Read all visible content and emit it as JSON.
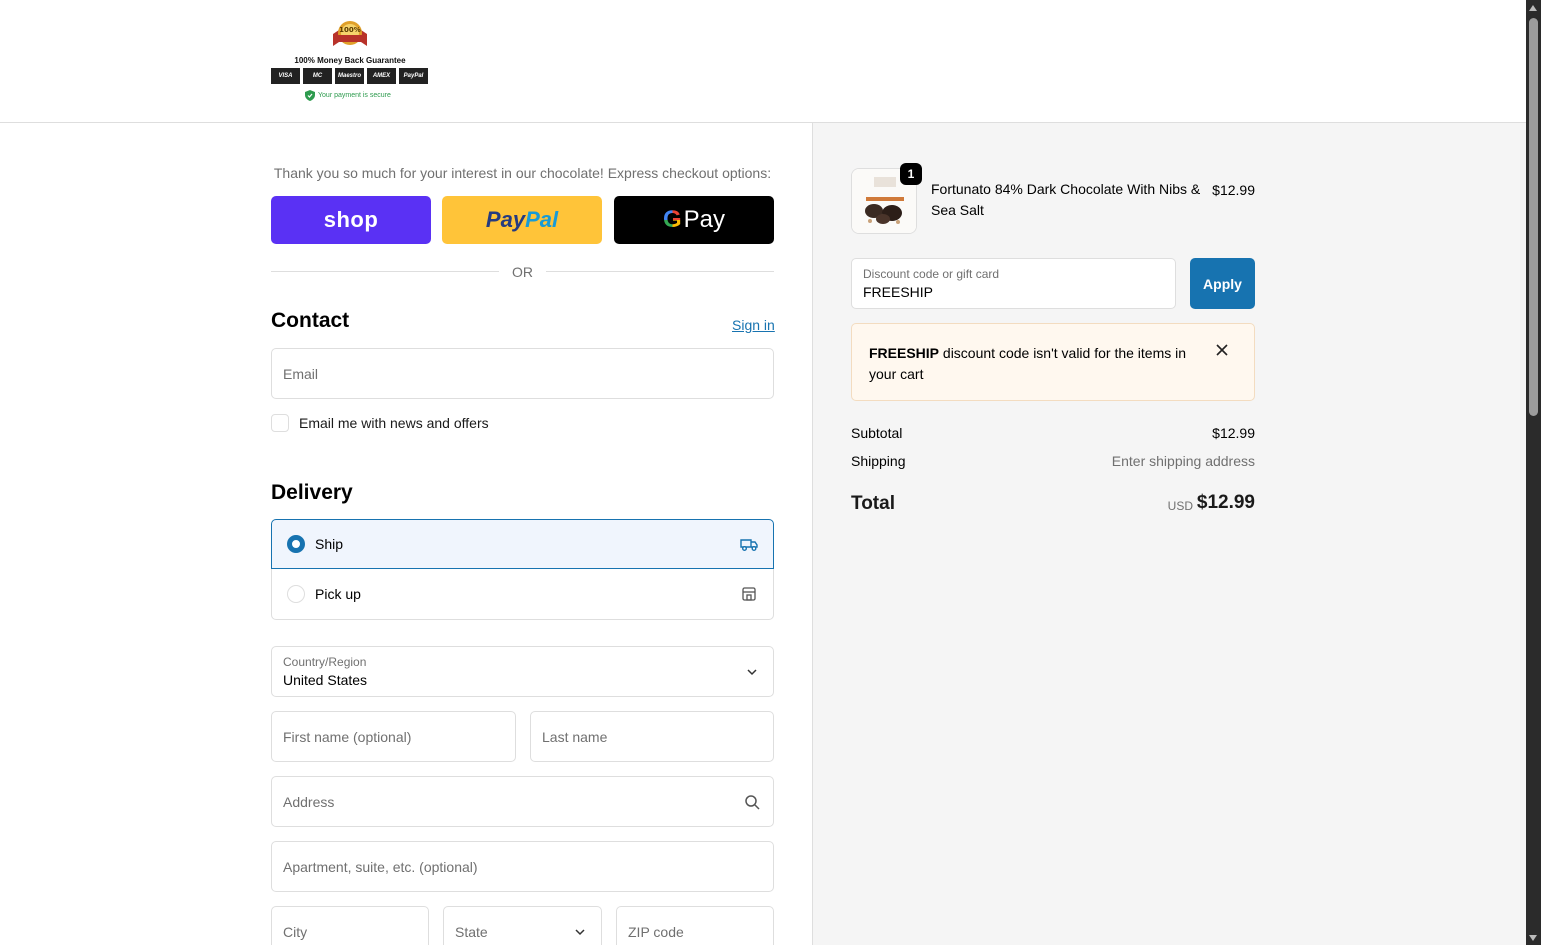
{
  "header": {
    "logo": {
      "seal_text": "100%",
      "guarantee": "100% Money Back Guarantee",
      "cards": [
        "VISA",
        "MC",
        "Maestro",
        "AMEX",
        "PayPal"
      ],
      "secure": "Your payment is secure"
    }
  },
  "express": {
    "title": "Thank you so much for your interest in our chocolate! Express checkout options:",
    "shop_label": "shop",
    "paypal_pay": "Pay",
    "paypal_pal": "Pal",
    "gpay_g": "G",
    "gpay_pay": "Pay",
    "or_label": "OR"
  },
  "contact": {
    "title": "Contact",
    "signin": "Sign in",
    "email_placeholder": "Email",
    "newsletter_label": "Email me with news and offers"
  },
  "delivery": {
    "title": "Delivery",
    "options": [
      {
        "label": "Ship",
        "selected": true,
        "icon": "truck-icon"
      },
      {
        "label": "Pick up",
        "selected": false,
        "icon": "store-icon"
      }
    ],
    "country_label": "Country/Region",
    "country_value": "United States",
    "first_name_placeholder": "First name (optional)",
    "last_name_placeholder": "Last name",
    "address_placeholder": "Address",
    "apartment_placeholder": "Apartment, suite, etc. (optional)",
    "city_placeholder": "City",
    "state_placeholder": "State",
    "zip_placeholder": "ZIP code"
  },
  "cart": {
    "item": {
      "quantity": "1",
      "name": "Fortunato 84% Dark Chocolate With Nibs & Sea Salt",
      "price": "$12.99"
    },
    "discount": {
      "label": "Discount code or gift card",
      "value": "FREESHIP",
      "apply_label": "Apply"
    },
    "notice": {
      "code": "FREESHIP",
      "message": " discount code isn't valid for the items in your cart"
    },
    "subtotal_label": "Subtotal",
    "subtotal_value": "$12.99",
    "shipping_label": "Shipping",
    "shipping_value": "Enter shipping address",
    "total_label": "Total",
    "currency": "USD",
    "total_value": "$12.99"
  },
  "colors": {
    "accent": "#1773b0",
    "shop": "#5a31f4",
    "paypal": "#ffc439",
    "gpay": "#000000"
  }
}
